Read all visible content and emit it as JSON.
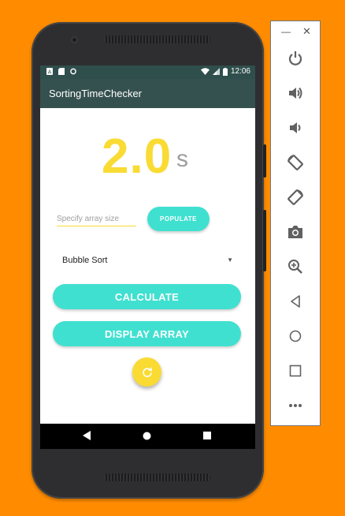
{
  "app": {
    "title": "SortingTimeChecker",
    "status_time": "12:06",
    "timer_value": "2.0",
    "timer_unit": "s"
  },
  "input": {
    "placeholder": "Specify array size",
    "value": ""
  },
  "buttons": {
    "populate": "POPULATE",
    "calculate": "CALCULATE",
    "display_array": "DISPLAY ARRAY"
  },
  "spinner": {
    "selected": "Bubble Sort"
  },
  "colors": {
    "accent_teal": "#40E0D0",
    "accent_yellow": "#F9DB34",
    "app_bar": "#35514f",
    "background": "#FF8C00"
  },
  "emulator": {
    "window_controls": [
      "minimize",
      "close"
    ],
    "tools": [
      "power-icon",
      "volume-up-icon",
      "volume-down-icon",
      "rotate-left-icon",
      "rotate-right-icon",
      "camera-icon",
      "zoom-icon",
      "back-icon",
      "home-icon",
      "overview-icon",
      "more-icon"
    ]
  }
}
